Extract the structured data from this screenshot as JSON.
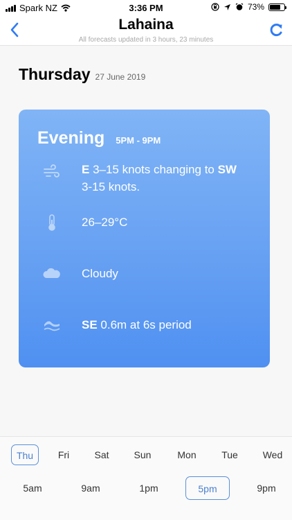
{
  "status_bar": {
    "carrier": "Spark NZ",
    "time": "3:36 PM",
    "battery_percent": "73%",
    "battery_level": 0.73
  },
  "header": {
    "title": "Lahaina",
    "subtitle": "All forecasts updated in 3 hours, 23 minutes",
    "back_icon": "chevron-left-icon",
    "refresh_icon": "refresh-icon",
    "accent_color": "#2f7bf5"
  },
  "day": {
    "name": "Thursday",
    "date": "27 June 2019"
  },
  "card": {
    "period": "Evening",
    "hours": "5PM - 9PM",
    "wind": {
      "icon": "wind-icon",
      "from_dir": "E",
      "from_text": " 3–15 knots changing to ",
      "to_dir": "SW",
      "to_text": "3-15 knots."
    },
    "temperature": {
      "icon": "thermometer-icon",
      "text": "26–29°C"
    },
    "sky": {
      "icon": "cloud-icon",
      "text": "Cloudy"
    },
    "swell": {
      "icon": "wave-icon",
      "dir": "SE",
      "text": " 0.6m at 6s period"
    },
    "gradient_top": "#80b4f6",
    "gradient_bottom": "#4f90f1"
  },
  "day_tabs": [
    {
      "label": "Thu",
      "selected": true
    },
    {
      "label": "Fri",
      "selected": false
    },
    {
      "label": "Sat",
      "selected": false
    },
    {
      "label": "Sun",
      "selected": false
    },
    {
      "label": "Mon",
      "selected": false
    },
    {
      "label": "Tue",
      "selected": false
    },
    {
      "label": "Wed",
      "selected": false
    }
  ],
  "time_tabs": [
    {
      "label": "5am",
      "selected": false
    },
    {
      "label": "9am",
      "selected": false
    },
    {
      "label": "1pm",
      "selected": false
    },
    {
      "label": "5pm",
      "selected": true
    },
    {
      "label": "9pm",
      "selected": false
    }
  ],
  "selected_tab_color": "#5a8fd8"
}
